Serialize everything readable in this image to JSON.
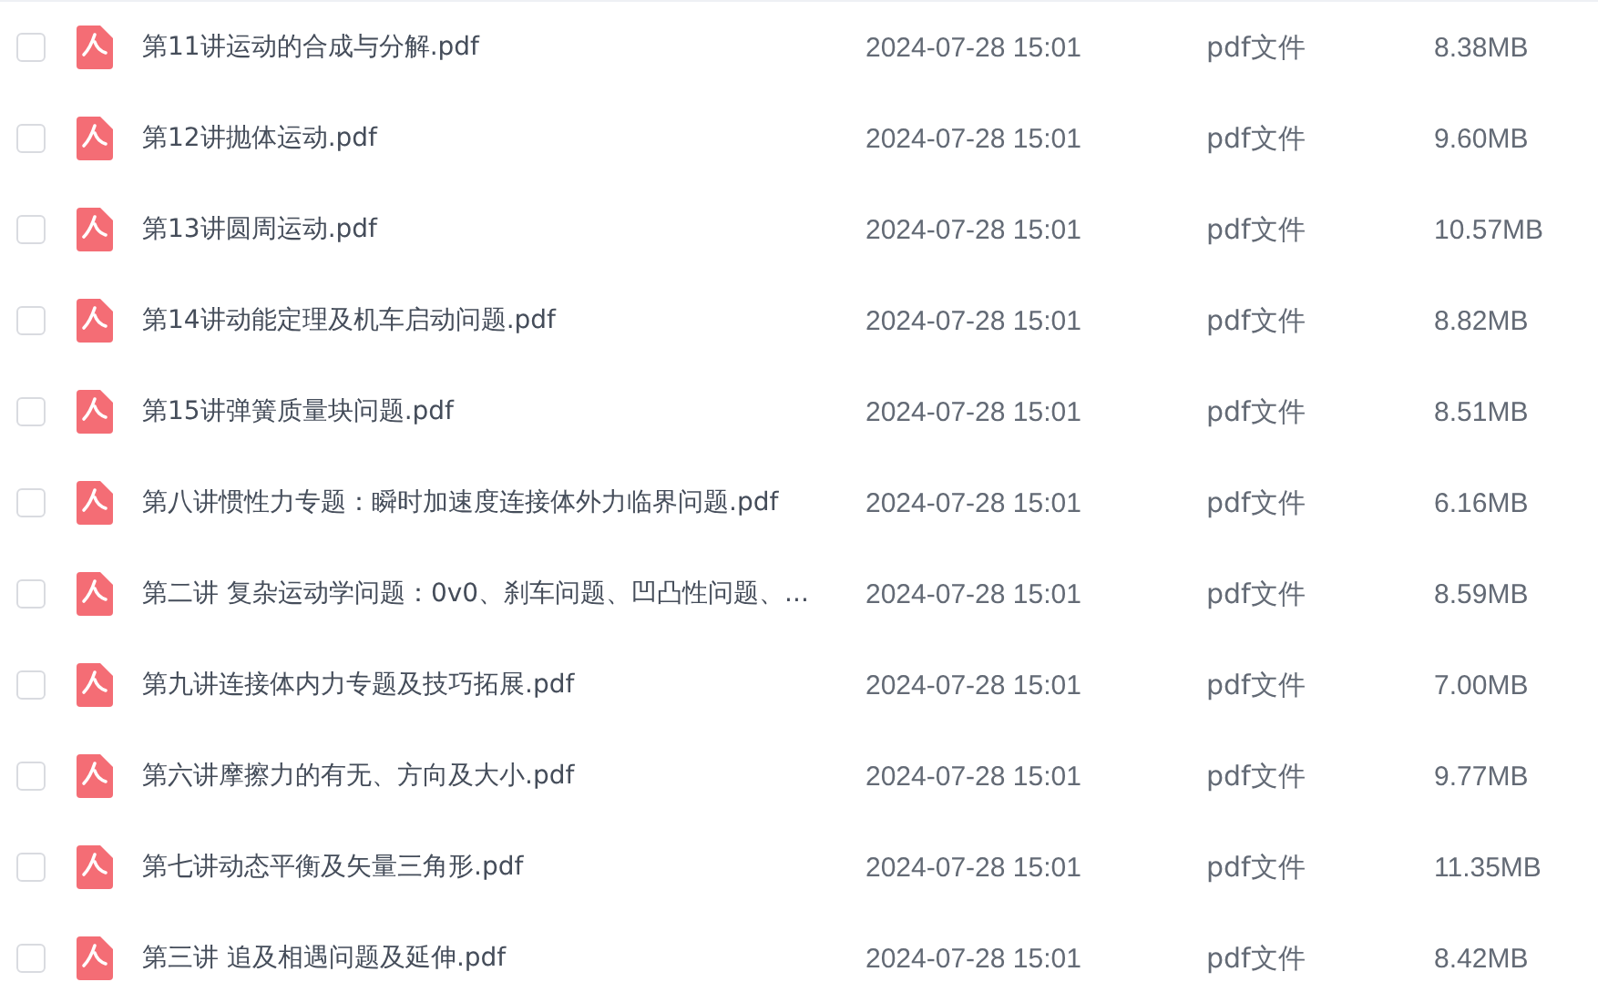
{
  "files": [
    {
      "name": "第11讲运动的合成与分解.pdf",
      "date": "2024-07-28 15:01",
      "type": "pdf文件",
      "size": "8.38MB",
      "checked": false
    },
    {
      "name": "第12讲抛体运动.pdf",
      "date": "2024-07-28 15:01",
      "type": "pdf文件",
      "size": "9.60MB",
      "checked": false
    },
    {
      "name": "第13讲圆周运动.pdf",
      "date": "2024-07-28 15:01",
      "type": "pdf文件",
      "size": "10.57MB",
      "checked": false
    },
    {
      "name": "第14讲动能定理及机车启动问题.pdf",
      "date": "2024-07-28 15:01",
      "type": "pdf文件",
      "size": "8.82MB",
      "checked": false
    },
    {
      "name": "第15讲弹簧质量块问题.pdf",
      "date": "2024-07-28 15:01",
      "type": "pdf文件",
      "size": "8.51MB",
      "checked": false
    },
    {
      "name": "第八讲惯性力专题：瞬时加速度连接体外力临界问题.pdf",
      "date": "2024-07-28 15:01",
      "type": "pdf文件",
      "size": "6.16MB",
      "checked": false
    },
    {
      "name": "第二讲 复杂运动学问题：0v0、刹车问题、凹凸性问题、...",
      "date": "2024-07-28 15:01",
      "type": "pdf文件",
      "size": "8.59MB",
      "checked": false
    },
    {
      "name": "第九讲连接体内力专题及技巧拓展.pdf",
      "date": "2024-07-28 15:01",
      "type": "pdf文件",
      "size": "7.00MB",
      "checked": false
    },
    {
      "name": "第六讲摩擦力的有无、方向及大小.pdf",
      "date": "2024-07-28 15:01",
      "type": "pdf文件",
      "size": "9.77MB",
      "checked": false
    },
    {
      "name": "第七讲动态平衡及矢量三角形.pdf",
      "date": "2024-07-28 15:01",
      "type": "pdf文件",
      "size": "11.35MB",
      "checked": false
    },
    {
      "name": "第三讲 追及相遇问题及延伸.pdf",
      "date": "2024-07-28 15:01",
      "type": "pdf文件",
      "size": "8.42MB",
      "checked": false
    }
  ]
}
